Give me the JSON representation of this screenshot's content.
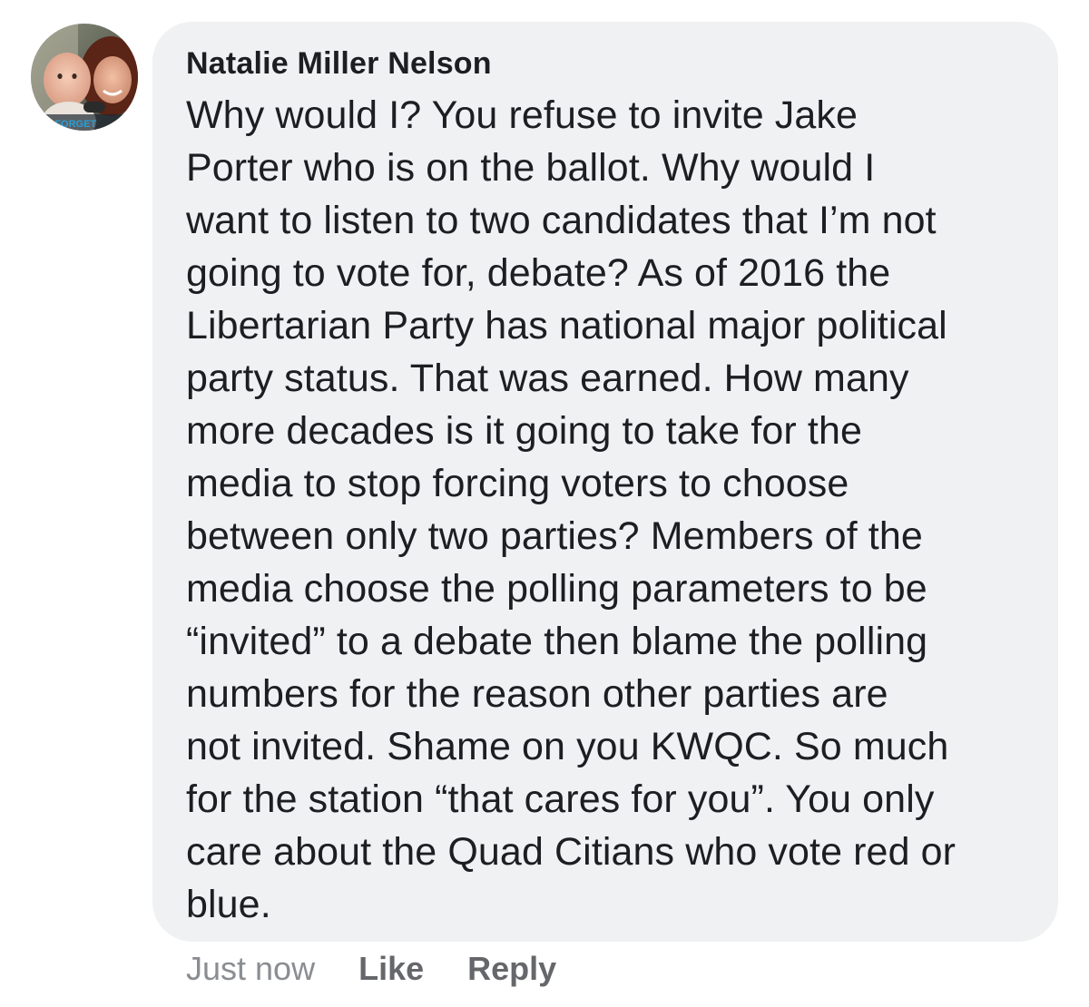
{
  "comment": {
    "author": "Natalie Miller Nelson",
    "body": "Why would I? You refuse to invite Jake\nPorter who is on the ballot. Why would I\nwant to listen to two candidates that I’m not\ngoing to vote for, debate? As of 2016 the\nLibertarian Party has national major political\nparty status. That was earned. How many\nmore decades is it going to take for the\nmedia to stop forcing voters to choose\nbetween only two parties? Members of the\nmedia choose the polling parameters to be\n“invited” to a debate then blame the polling\nnumbers for the reason other parties are\nnot invited. Shame on you KWQC. So much\nfor the station “that cares for you”. You only\ncare about the Quad Citians who vote red or\nblue.",
    "timestamp": "Just now",
    "like_label": "Like",
    "reply_label": "Reply",
    "avatar_overlay_text": "ER FORGET"
  },
  "colors": {
    "bubble_background": "#f0f1f3",
    "text": "#1c1e21",
    "action_text": "#65676b",
    "timestamp_text": "#8a8d91",
    "avatar_overlay_text": "#2a9fd6"
  }
}
